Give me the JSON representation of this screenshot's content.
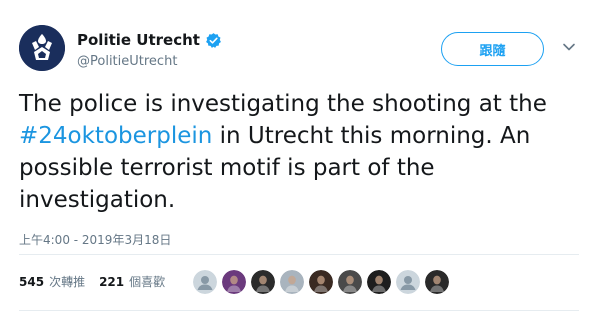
{
  "tweet": {
    "display_name": "Politie Utrecht",
    "handle": "@PolitieUtrecht",
    "follow_label": "跟隨",
    "text_before": "The police is investigating the shooting at the ",
    "hashtag": "#24oktoberplein",
    "text_after": " in Utrecht this morning. An possible terrorist motif is part of the investigation.",
    "timestamp": "上午4:00 - 2019年3月18日"
  },
  "stats": {
    "retweets_count": "545",
    "retweets_label": "次轉推",
    "likes_count": "221",
    "likes_label": "個喜歡"
  },
  "likers": [
    {
      "icon": "default-avatar",
      "color": "#8899a6"
    },
    {
      "icon": "person-photo-avatar",
      "color": "#6b3a7d"
    },
    {
      "icon": "person-photo-avatar",
      "color": "#2b2b2b"
    },
    {
      "icon": "person-photo-avatar",
      "color": "#a9b4be"
    },
    {
      "icon": "person-photo-avatar",
      "color": "#3a2a22"
    },
    {
      "icon": "person-photo-avatar",
      "color": "#4a4a4a"
    },
    {
      "icon": "person-photo-avatar",
      "color": "#1e1e1e"
    },
    {
      "icon": "default-avatar",
      "color": "#8899a6"
    },
    {
      "icon": "person-photo-avatar",
      "color": "#2a2a2a"
    }
  ],
  "colors": {
    "accent": "#1da1f2",
    "hashtag": "#1b95e0",
    "muted": "#657786",
    "avatar_bg": "#1a2e5c"
  }
}
